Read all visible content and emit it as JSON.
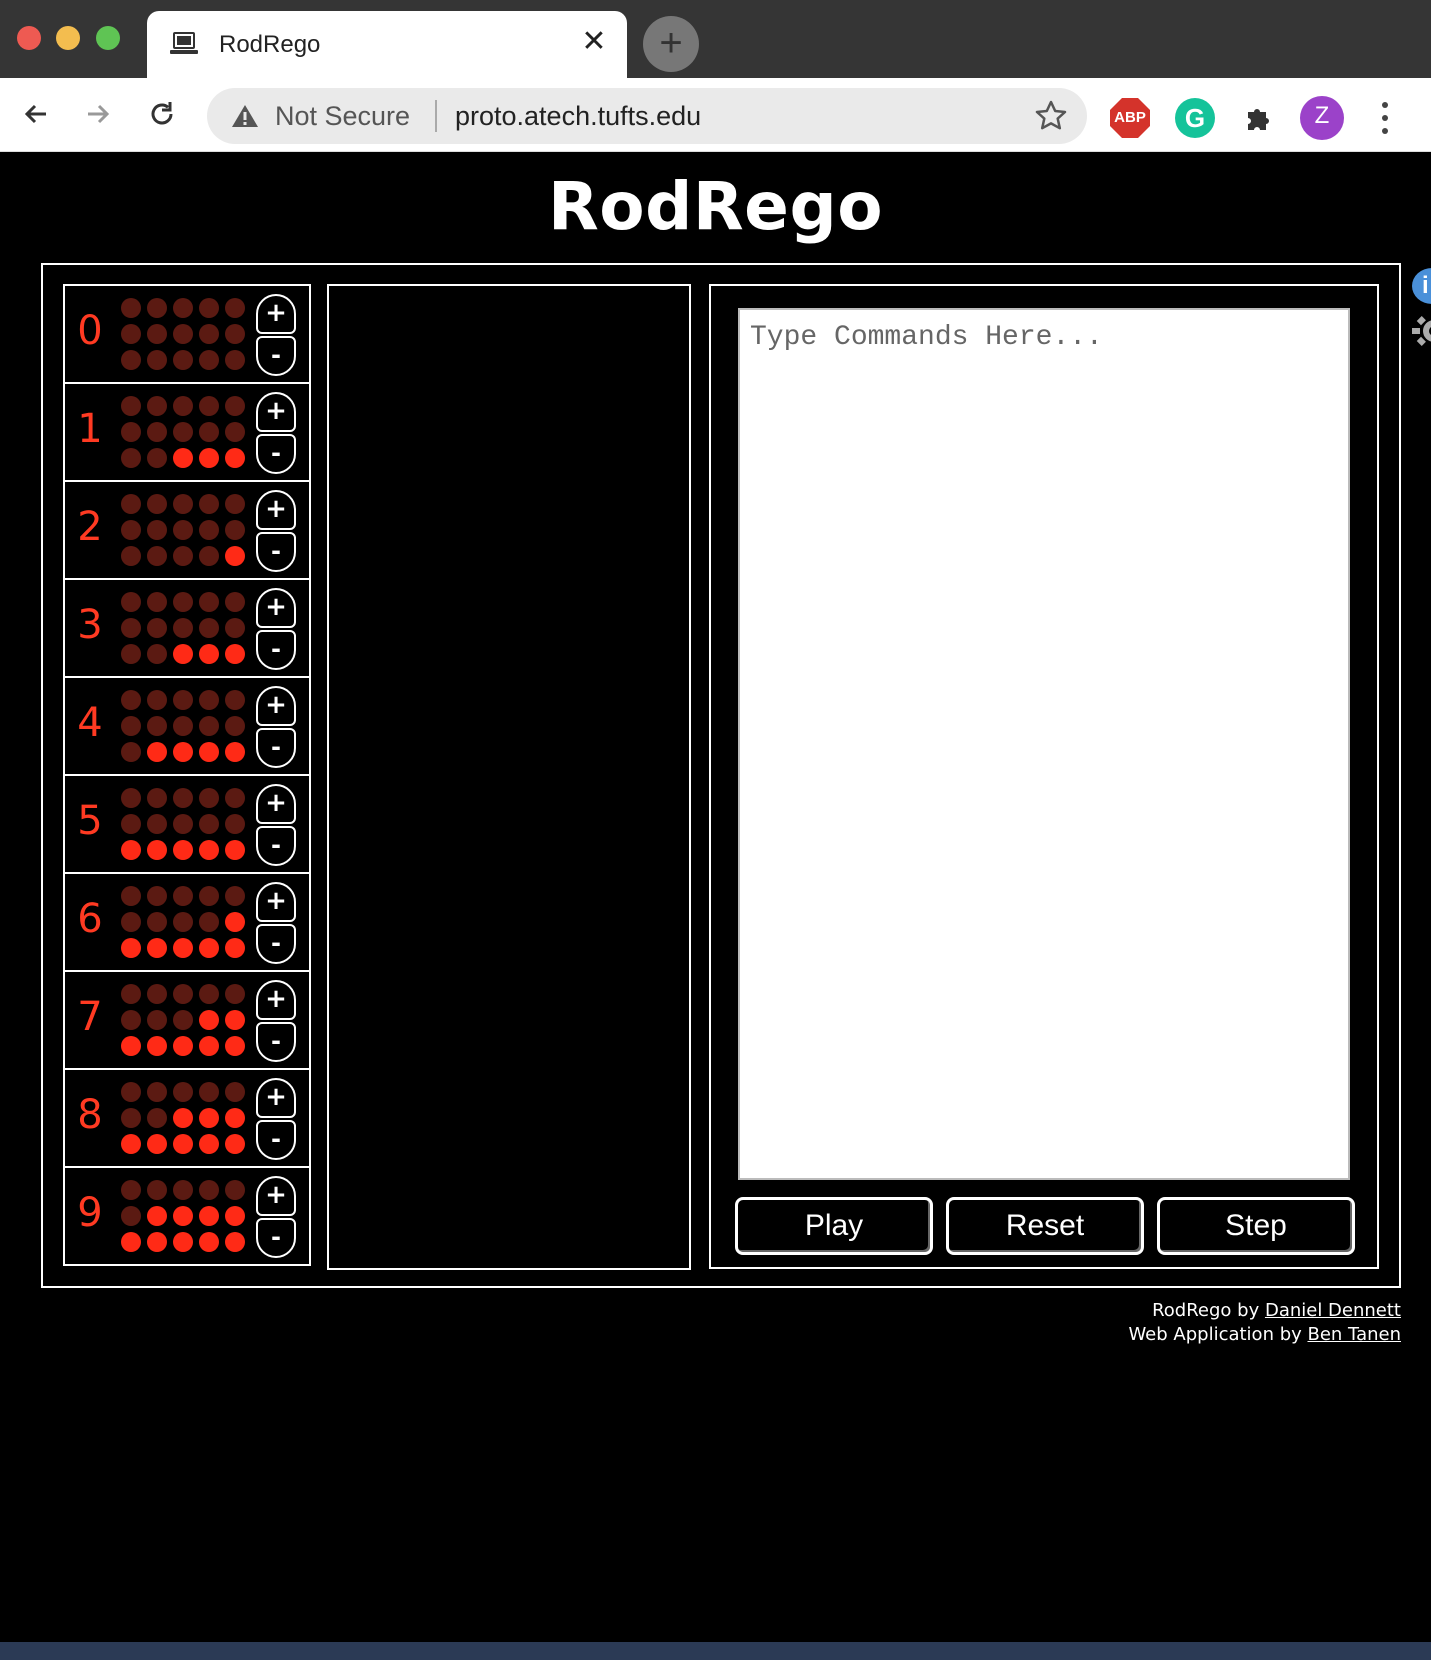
{
  "browser": {
    "tab_title": "RodRego",
    "tab_close": "✕",
    "new_tab": "+",
    "security_label": "Not Secure",
    "url": "proto.atech.tufts.edu",
    "ext_abp": "ABP",
    "ext_grammarly": "G",
    "avatar_letter": "Z"
  },
  "page": {
    "title": "RodRego"
  },
  "registers": [
    {
      "label": "0",
      "value": 0
    },
    {
      "label": "1",
      "value": 3
    },
    {
      "label": "2",
      "value": 1
    },
    {
      "label": "3",
      "value": 3
    },
    {
      "label": "4",
      "value": 4
    },
    {
      "label": "5",
      "value": 5
    },
    {
      "label": "6",
      "value": 6
    },
    {
      "label": "7",
      "value": 7
    },
    {
      "label": "8",
      "value": 8
    },
    {
      "label": "9",
      "value": 9
    }
  ],
  "beads_per_register": 15,
  "register_buttons": {
    "plus": "+",
    "minus": "-"
  },
  "editor": {
    "placeholder": "Type Commands Here..."
  },
  "controls": {
    "play": "Play",
    "reset": "Reset",
    "step": "Step"
  },
  "side": {
    "info": "i"
  },
  "credits": {
    "line1_prefix": "RodRego by ",
    "line1_link": "Daniel Dennett",
    "line2_prefix": "Web Application by ",
    "line2_link": "Ben Tanen"
  },
  "colors": {
    "bead_on": "#ff2a16",
    "bead_off": "#5b1a12",
    "register_number": "#ff3a22"
  }
}
